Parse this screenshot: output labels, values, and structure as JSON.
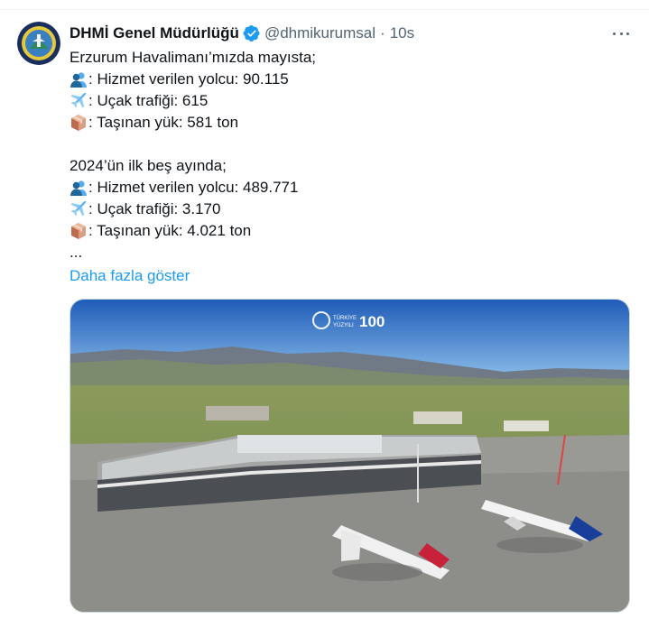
{
  "tweet": {
    "author_name": "DHMİ Genel Müdürlüğü",
    "handle": "@dhmikurumsal",
    "separator": "·",
    "time": "10s",
    "lines": [
      {
        "icon": "passengers-icon",
        "text": ": Hizmet verilen yolcu: 90.115"
      },
      {
        "icon": "airplane-icon",
        "text": ": Uçak trafiği: 615"
      },
      {
        "icon": "package-icon",
        "text": ": Taşınan yük: 581 ton"
      }
    ],
    "lines2": [
      {
        "icon": "passengers-icon",
        "text": ": Hizmet verilen yolcu: 489.771"
      },
      {
        "icon": "airplane-icon",
        "text": ": Uçak trafiği: 3.170"
      },
      {
        "icon": "package-icon",
        "text": ": Taşınan yük: 4.021 ton"
      }
    ],
    "intro": "Erzurum Havalimanı’mızda mayısta;",
    "intro2": "2024’ün ilk beş ayında;",
    "ellipsis": "...",
    "show_more": "Daha fazla göster",
    "media": {
      "logo_text_1": "TÜRKİYE",
      "logo_text_2": "YÜZYILI",
      "logo_number": "100"
    }
  },
  "colors": {
    "link": "#1d9bf0",
    "secondary_text": "#536471",
    "verified_badge": "#1d9bf0"
  }
}
